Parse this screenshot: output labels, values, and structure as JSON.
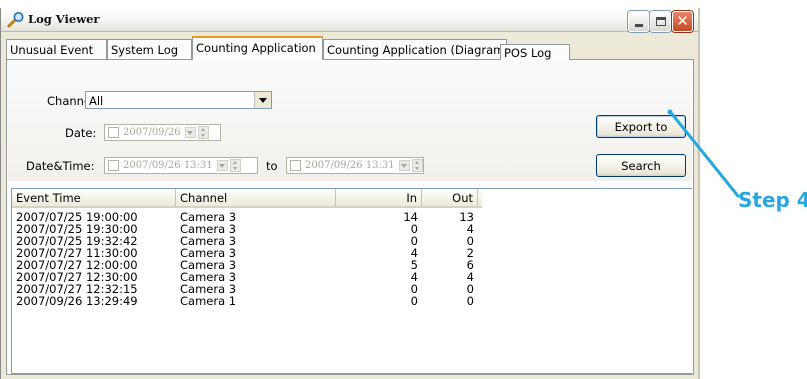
{
  "window": {
    "title": "Log Viewer"
  },
  "tabs": [
    {
      "label": "Unusual Event"
    },
    {
      "label": "System Log"
    },
    {
      "label": "Counting Application",
      "active": true
    },
    {
      "label": "Counting Application (Diagram)"
    },
    {
      "label": "POS Log"
    }
  ],
  "filters": {
    "channel_label": "Channel:",
    "channel_value": "All",
    "date_label": "Date:",
    "date_value": "2007/09/26",
    "datetime_label": "Date&Time:",
    "datetime_from": "2007/09/26 13:31",
    "to_label": "to",
    "datetime_to": "2007/09/26 13:31"
  },
  "buttons": {
    "export": "Export to",
    "search": "Search"
  },
  "table": {
    "columns": [
      "Event Time",
      "Channel",
      "In",
      "Out"
    ],
    "rows": [
      [
        "2007/07/25 19:00:00",
        "Camera 3",
        "14",
        "13"
      ],
      [
        "2007/07/25 19:30:00",
        "Camera 3",
        "0",
        "4"
      ],
      [
        "2007/07/25 19:32:42",
        "Camera 3",
        "0",
        "0"
      ],
      [
        "2007/07/27 11:30:00",
        "Camera 3",
        "4",
        "2"
      ],
      [
        "2007/07/27 12:00:00",
        "Camera 3",
        "5",
        "6"
      ],
      [
        "2007/07/27 12:30:00",
        "Camera 3",
        "4",
        "4"
      ],
      [
        "2007/07/27 12:32:15",
        "Camera 3",
        "0",
        "0"
      ],
      [
        "2007/09/26 13:29:49",
        "Camera 1",
        "0",
        "0"
      ]
    ]
  },
  "annotation": {
    "label": "Step 4",
    "color": "#27a6e0"
  }
}
